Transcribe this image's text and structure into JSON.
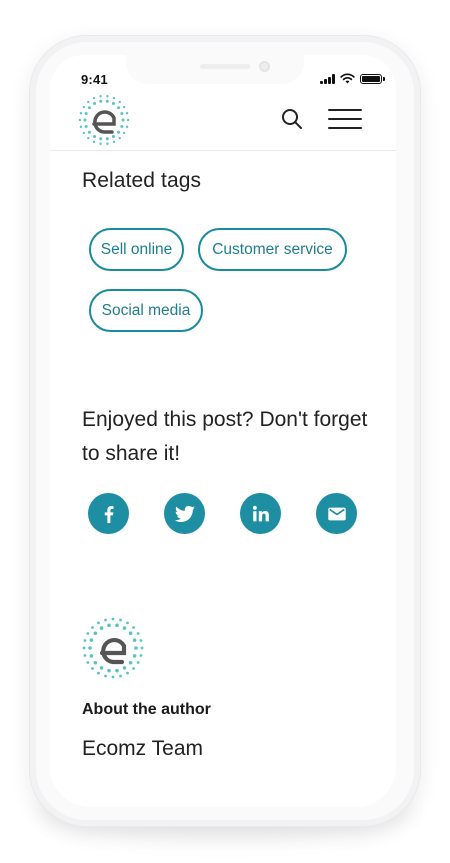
{
  "status_bar": {
    "time": "9:41"
  },
  "header": {
    "logo_icon": "ecomz-e-logo-icon",
    "search_icon": "search-icon",
    "menu_icon": "hamburger-menu-icon"
  },
  "related_tags": {
    "title": "Related tags",
    "tags": [
      "Sell online",
      "Customer service",
      "Social media"
    ]
  },
  "share": {
    "text": "Enjoyed this post? Don't forget to share it!",
    "buttons": [
      "facebook-icon",
      "twitter-icon",
      "linkedin-icon",
      "email-icon"
    ]
  },
  "author": {
    "label": "About the author",
    "name": "Ecomz Team"
  },
  "colors": {
    "accent": "#1e8ea3",
    "logo_dots": "#5cc3c4",
    "text": "#222222"
  }
}
